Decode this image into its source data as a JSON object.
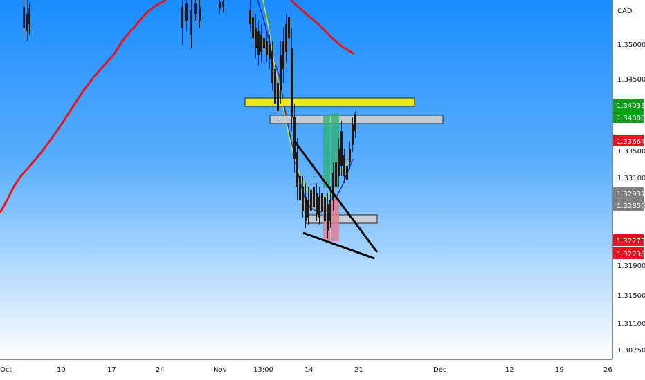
{
  "chart_data": {
    "type": "candlestick",
    "currency": "CAD",
    "x_labels": [
      "Oct",
      "10",
      "17",
      "24",
      "Nov",
      "13:00",
      "14",
      "21",
      "Dec",
      "12",
      "19",
      "26"
    ],
    "y_ticks": [
      "1.35000",
      "1.34500",
      "1.33500",
      "1.33100",
      "1.32850",
      "1.31900",
      "1.31500",
      "1.31100",
      "1.30750"
    ],
    "price_badges": [
      {
        "value": "1.34033",
        "color": "#0a9e1a"
      },
      {
        "value": "1.34000",
        "color": "#0a9e1a"
      },
      {
        "value": "1.33664",
        "color": "#e3121d"
      },
      {
        "value": "1.32937",
        "color": "#808080"
      },
      {
        "value": "1.32850",
        "color": "#808080"
      },
      {
        "value": "1.32275",
        "color": "#e3121d"
      },
      {
        "value": "1.32238",
        "color": "#e3121d"
      }
    ],
    "moving_averages": [
      {
        "color": "#e8121b"
      },
      {
        "color": "#1b2ccc"
      },
      {
        "color": "#e4e400"
      }
    ],
    "zones": [
      {
        "kind": "resistance",
        "color": "#ffee00"
      },
      {
        "kind": "resistance",
        "color": "#cfcfcf"
      },
      {
        "kind": "support",
        "color": "#cfcfcf"
      }
    ],
    "colors": {
      "background_top": "#1a90ff",
      "background_bottom": "#ffffff",
      "candle": "#1a1a1a",
      "buy_box": "#2db46b",
      "sell_box": "#e87b8e",
      "trendline": "#000000"
    }
  }
}
